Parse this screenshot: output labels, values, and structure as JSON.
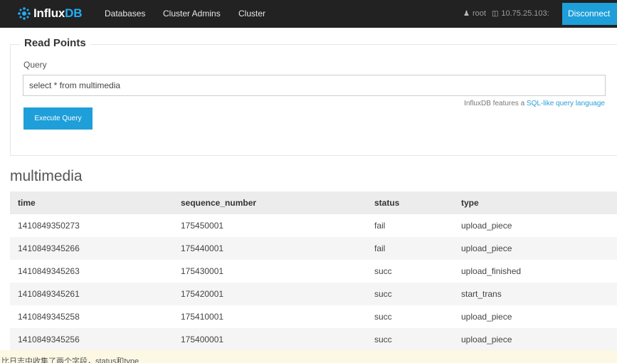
{
  "navbar": {
    "brand_a": "Influx",
    "brand_b": "DB",
    "links": [
      "Databases",
      "Cluster Admins",
      "Cluster"
    ],
    "user": "root",
    "host": "10.75.25.103:",
    "disconnect_label": "Disconnect"
  },
  "read_points": {
    "legend": "Read Points",
    "query_label": "Query",
    "query_value": "select * from multimedia",
    "help_prefix": "InfluxDB features a",
    "help_link": "SQL-like query language",
    "execute_label": "Execute Query"
  },
  "results": {
    "series_name": "multimedia",
    "columns": [
      "time",
      "sequence_number",
      "status",
      "type"
    ],
    "rows": [
      [
        "1410849350273",
        "175450001",
        "fail",
        "upload_piece"
      ],
      [
        "1410849345266",
        "175440001",
        "fail",
        "upload_piece"
      ],
      [
        "1410849345263",
        "175430001",
        "succ",
        "upload_finished"
      ],
      [
        "1410849345261",
        "175420001",
        "succ",
        "start_trans"
      ],
      [
        "1410849345258",
        "175410001",
        "succ",
        "upload_piece"
      ],
      [
        "1410849345256",
        "175400001",
        "succ",
        "upload_piece"
      ]
    ]
  },
  "bottom_note": "比日志中收集了两个字段，status和type",
  "colors": {
    "navbar_bg": "#222222",
    "accent": "#1e9fd9",
    "brand_accent": "#22adf6",
    "note_bg": "#fcf8e3"
  }
}
